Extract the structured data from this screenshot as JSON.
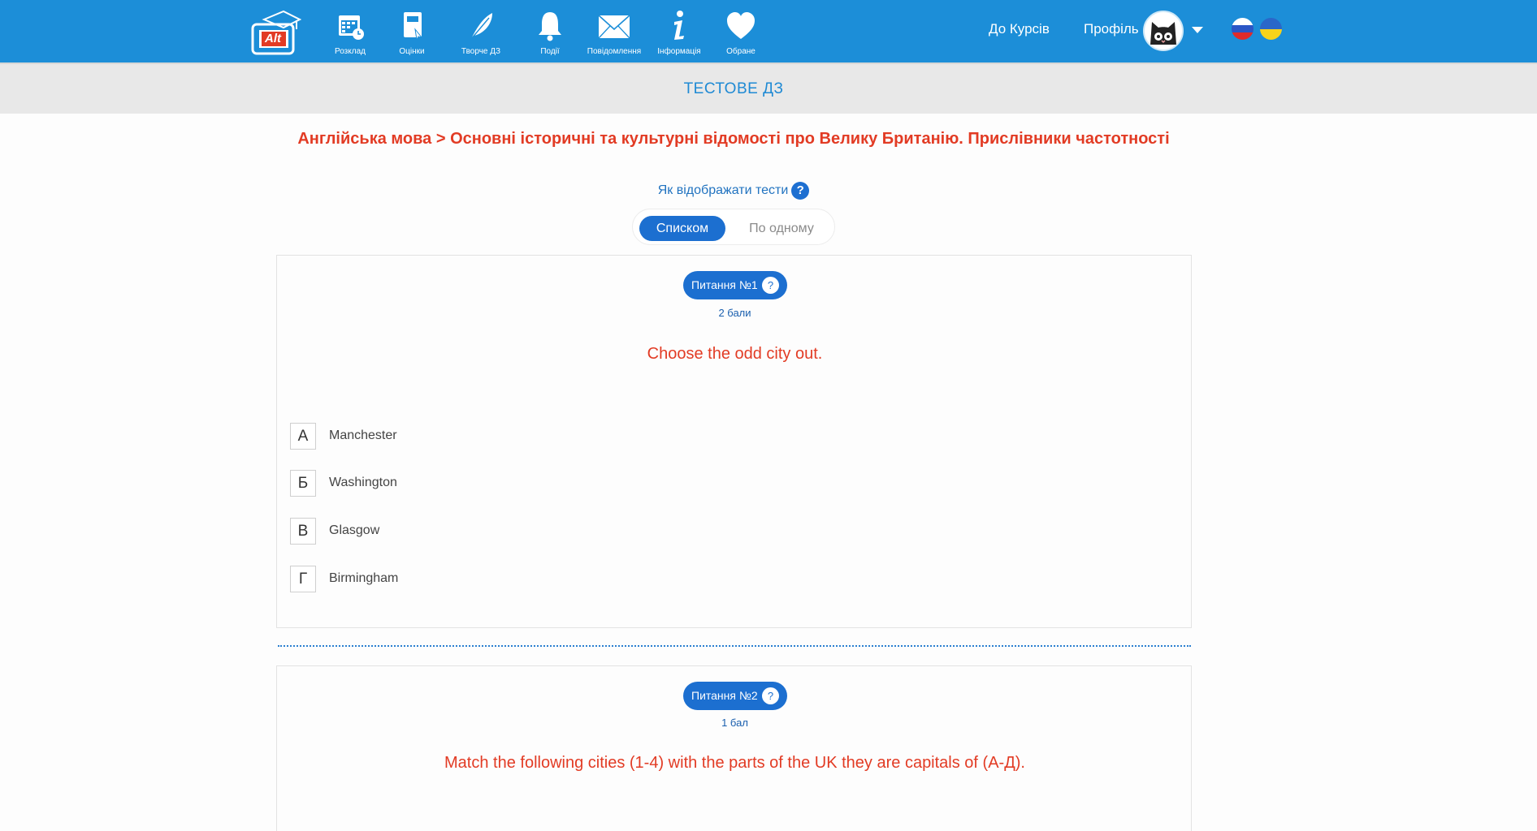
{
  "header": {
    "logo_text": "Alt",
    "nav": [
      {
        "label": "Розклад",
        "icon": "calendar-icon"
      },
      {
        "label": "Оцінки",
        "icon": "gradebook-icon"
      },
      {
        "label": "Творче ДЗ",
        "icon": "feather-icon"
      },
      {
        "label": "Події",
        "icon": "bell-icon"
      },
      {
        "label": "Повідомлення",
        "icon": "envelope-icon"
      },
      {
        "label": "Інформація",
        "icon": "info-icon"
      },
      {
        "label": "Обране",
        "icon": "heart-icon"
      }
    ],
    "courses_link": "До Курсів",
    "profile_label": "Профіль",
    "colors": {
      "bar": "#1c8ed8"
    }
  },
  "subheader": {
    "title": "ТЕСТОВЕ ДЗ"
  },
  "breadcrumb": "Англійська мова > Основні історичні та культурні відомості про Велику Британію. Прислівники частотності",
  "display_mode": {
    "label": "Як відображати тести",
    "help": "?",
    "options": [
      "Списком",
      "По одному"
    ],
    "selected": "Списком"
  },
  "questions": [
    {
      "badge": "Питання №1",
      "points": "2 бали",
      "text": "Choose the odd city out.",
      "options": [
        {
          "letter": "А",
          "text": "Manchester"
        },
        {
          "letter": "Б",
          "text": "Washington"
        },
        {
          "letter": "В",
          "text": "Glasgow"
        },
        {
          "letter": "Г",
          "text": "Birmingham"
        }
      ]
    },
    {
      "badge": "Питання №2",
      "points": "1 бал",
      "text": "Match the following cities (1-4) with the parts of the UK they are capitals of (А-Д)."
    }
  ]
}
